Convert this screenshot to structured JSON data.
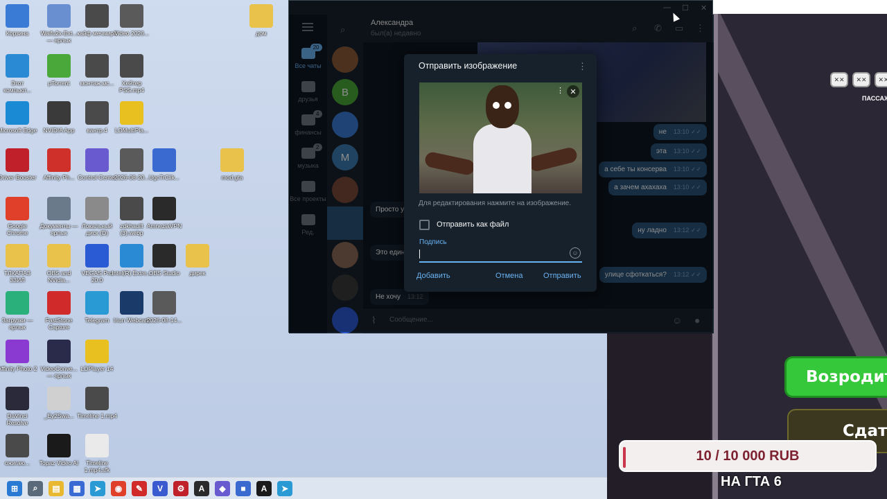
{
  "desktop": {
    "icons": [
      {
        "label": "Корзина",
        "icon": "recycle-bin-icon",
        "color": "#3a7bd5"
      },
      {
        "label": "Waifu2x-Ext... — ярлык",
        "icon": "waifu-icon",
        "color": "#6a8fd0"
      },
      {
        "label": "кайф мечмир4",
        "icon": "video-file-icon",
        "color": "#4a4a4a"
      },
      {
        "label": "Video 2026...",
        "icon": "video-file-icon",
        "color": "#5a5a5a"
      },
      {
        "label": "дом",
        "icon": "folder-icon",
        "color": "#e8c24a"
      },
      {
        "label": "Этот компьют...",
        "icon": "computer-icon",
        "color": "#2a8ad4"
      },
      {
        "label": "µTorrent",
        "icon": "utorrent-icon",
        "color": "#4aa83a"
      },
      {
        "label": "монтаж.мс...",
        "icon": "video-file-icon",
        "color": "#4a4a4a"
      },
      {
        "label": "Хейтер PSS.mp4",
        "icon": "video-file-icon",
        "color": "#4a4a4a"
      },
      {
        "label": "Microsoft Edge",
        "icon": "edge-icon",
        "color": "#1a8ad4"
      },
      {
        "label": "NVIDIA App",
        "icon": "nvidia-icon",
        "color": "#3a3a3a"
      },
      {
        "label": "вантр.4",
        "icon": "video-file-icon",
        "color": "#4a4a4a"
      },
      {
        "label": "LDMultiPla...",
        "icon": "ldmulti-icon",
        "color": "#e8c020"
      },
      {
        "label": "Driver Booster",
        "icon": "driver-booster-icon",
        "color": "#c0202a"
      },
      {
        "label": "Affinity Ph...",
        "icon": "pdf-icon",
        "color": "#d0302a"
      },
      {
        "label": "Control Center",
        "icon": "control-center-icon",
        "color": "#6a5ad0"
      },
      {
        "label": "2026-08-20...",
        "icon": "image-file-icon",
        "color": "#5a5a5a"
      },
      {
        "label": "UgcTrClik...",
        "icon": "image-file-icon",
        "color": "#3a6ad0"
      },
      {
        "label": "mod.gta",
        "icon": "folder-icon",
        "color": "#e8c24a"
      },
      {
        "label": "Google Chrome",
        "icon": "chrome-icon",
        "color": "#e0402a"
      },
      {
        "label": "Документы — ярлык",
        "icon": "documents-icon",
        "color": "#6a7a8a"
      },
      {
        "label": "Локальный диск (D)",
        "icon": "disk-icon",
        "color": "#8a8a8a"
      },
      {
        "label": "zdkhauilt (3).webp",
        "icon": "image-file-icon",
        "color": "#4a4a4a"
      },
      {
        "label": "AmneziaVPN",
        "icon": "vpn-icon",
        "color": "#2a2a2a"
      },
      {
        "label": "ТЛКАПАЗ 3ЗИЛ",
        "icon": "folder-icon",
        "color": "#e8c24a"
      },
      {
        "label": "OBS and NVidia...",
        "icon": "folder-icon",
        "color": "#e8c24a"
      },
      {
        "label": "VEGAS Pro 20.0",
        "icon": "vegas-icon",
        "color": "#2a5ad4"
      },
      {
        "label": "Intel(R) Extre...",
        "icon": "intel-icon",
        "color": "#2a8ad4"
      },
      {
        "label": "OBS Studio",
        "icon": "obs-icon",
        "color": "#2a2a2a"
      },
      {
        "label": "дирек",
        "icon": "folder-icon",
        "color": "#e8c24a"
      },
      {
        "label": "Загрузки — ярлык",
        "icon": "downloads-icon",
        "color": "#2ab07a"
      },
      {
        "label": "FastStone Capture",
        "icon": "faststone-icon",
        "color": "#d02a2a"
      },
      {
        "label": "Telegram",
        "icon": "telegram-icon",
        "color": "#2a9ad4"
      },
      {
        "label": "Iriun Webcam",
        "icon": "webcam-icon",
        "color": "#1a3a6a"
      },
      {
        "label": "2026-08-14...",
        "icon": "image-file-icon",
        "color": "#5a5a5a"
      },
      {
        "label": "Affinity Photo 2",
        "icon": "affinity-icon",
        "color": "#8a3ad0"
      },
      {
        "label": "VideoConve... — ярлык",
        "icon": "video-converter-icon",
        "color": "#2a2a4a"
      },
      {
        "label": "LDPlayer 14",
        "icon": "ldplayer-icon",
        "color": "#e8c020"
      },
      {
        "label": "DaVinci Resolve",
        "icon": "davinci-icon",
        "color": "#2a2a3a"
      },
      {
        "label": "_Ey2Swa...",
        "icon": "keyboard-icon",
        "color": "#d0d0d0"
      },
      {
        "label": "Timeline 1.mp4",
        "icon": "video-file-icon",
        "color": "#4a4a4a"
      },
      {
        "label": "ожигаю...",
        "icon": "video-file-icon",
        "color": "#4a4a4a"
      },
      {
        "label": "Topaz Video AI",
        "icon": "topaz-icon",
        "color": "#1a1a1a"
      },
      {
        "label": "Timeline 1.mp4.sfk",
        "icon": "file-icon",
        "color": "#eaeaea"
      }
    ]
  },
  "taskbar": {
    "items": [
      {
        "name": "start-icon",
        "color": "#2a7ad4",
        "glyph": "⊞"
      },
      {
        "name": "search-icon",
        "color": "#5a6a7a",
        "glyph": "⌕"
      },
      {
        "name": "file-explorer-icon",
        "color": "#e8b830",
        "glyph": "▤"
      },
      {
        "name": "store-icon",
        "color": "#3a6ad4",
        "glyph": "▦"
      },
      {
        "name": "telegram-icon",
        "color": "#2a9ad4",
        "glyph": "➤"
      },
      {
        "name": "chrome-icon",
        "color": "#e0402a",
        "glyph": "◉"
      },
      {
        "name": "faststone-icon",
        "color": "#d02a2a",
        "glyph": "✎"
      },
      {
        "name": "vpn-icon",
        "color": "#3a5ad0",
        "glyph": "V"
      },
      {
        "name": "driver-booster-icon",
        "color": "#c0202a",
        "glyph": "⚙"
      },
      {
        "name": "vpn-amnezia-icon",
        "color": "#2a2a2a",
        "glyph": "A"
      },
      {
        "name": "control-center-icon",
        "color": "#6a5ad0",
        "glyph": "◆"
      },
      {
        "name": "app-icon",
        "color": "#3a6ad0",
        "glyph": "■"
      },
      {
        "name": "text-app-icon",
        "color": "#1a1a1a",
        "glyph": "A"
      },
      {
        "name": "telegram-active-icon",
        "color": "#2a9ad4",
        "glyph": "➤"
      }
    ]
  },
  "telegram": {
    "sidebar": [
      {
        "label": "Все чаты",
        "badge": "20",
        "active": true
      },
      {
        "label": "друзья",
        "badge": "",
        "active": false
      },
      {
        "label": "финансы",
        "badge": "4",
        "active": false
      },
      {
        "label": "музыка",
        "badge": "2",
        "active": false
      },
      {
        "label": "Все проекты",
        "badge": "",
        "active": false
      },
      {
        "label": "Ред.",
        "badge": "",
        "active": false
      }
    ],
    "avatars": [
      {
        "letter": "",
        "color": "#8a5a3a"
      },
      {
        "letter": "В",
        "color": "#4aa83a"
      },
      {
        "letter": "",
        "color": "#3a7ad4"
      },
      {
        "letter": "М",
        "color": "#3a7ab0"
      },
      {
        "letter": "",
        "color": "#7a4a3a"
      },
      {
        "letter": "",
        "color": "#3a2a2a"
      },
      {
        "letter": "",
        "color": "#8a6a5a"
      },
      {
        "letter": "",
        "color": "#3a3a3a"
      },
      {
        "letter": "",
        "color": "#2a5ad4"
      }
    ],
    "header": {
      "name": "Александра",
      "status": "был(а) недавно"
    },
    "messages_out": [
      {
        "text": "не",
        "time": "13:10"
      },
      {
        "text": "эта",
        "time": "13:10"
      },
      {
        "text": "а себе ты консерва",
        "time": "13:10"
      },
      {
        "text": "а зачем ахахаха",
        "time": "13:10"
      },
      {
        "text": "ну ладно",
        "time": "13:12"
      },
      {
        "text": "улице сфоткаться?",
        "time": "13:12"
      }
    ],
    "messages_in": [
      {
        "text": "Просто у",
        "time": ""
      },
      {
        "text": "Это един",
        "time": ""
      },
      {
        "text": "Не хочу",
        "time": "13:12"
      }
    ],
    "compose_placeholder": "Сообщение..."
  },
  "dialog": {
    "title": "Отправить изображение",
    "hint": "Для редактирования нажмите на изображение.",
    "send_as_file": "Отправить как файл",
    "caption_label": "Подпись",
    "add": "Добавить",
    "cancel": "Отмена",
    "send": "Отправить"
  },
  "game": {
    "revive": "Возродить",
    "surrender": "Сдат",
    "passenger": "ПАССАЖ",
    "donation": "10 / 10 000 RUB",
    "title": "НА ГТА 6"
  }
}
